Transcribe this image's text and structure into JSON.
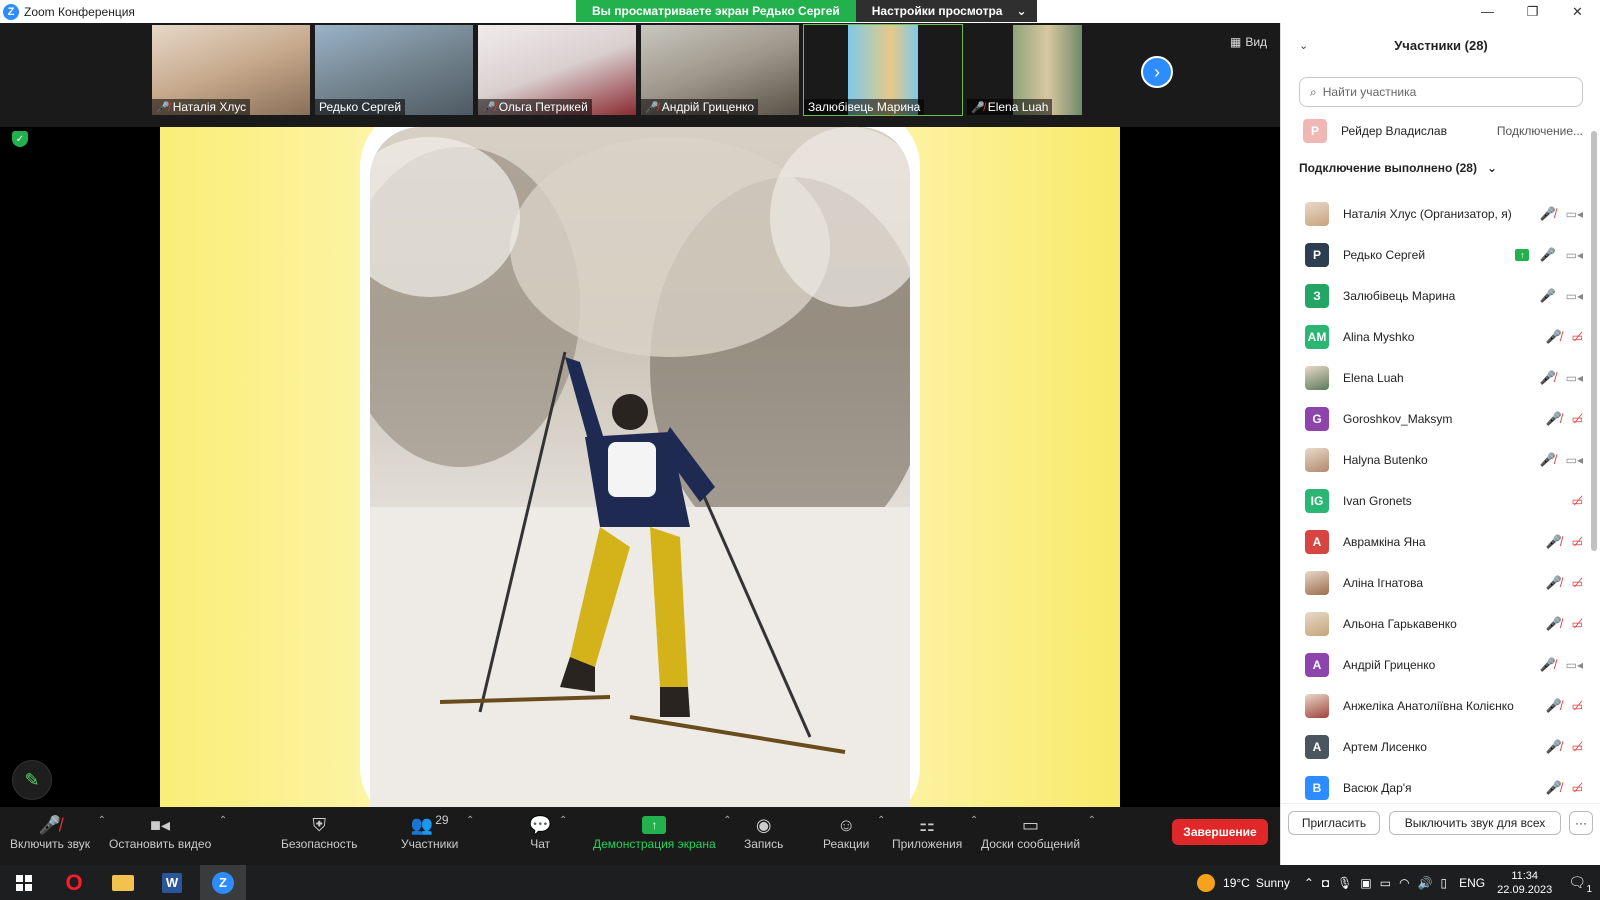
{
  "window": {
    "app_title": "Zoom Конференция",
    "share_banner": "Вы просматриваете экран Редько Сергей",
    "view_settings": "Настройки просмотра",
    "view_label": "Вид"
  },
  "video_tiles": [
    {
      "name": "Наталія Хлус",
      "muted": true
    },
    {
      "name": "Редько Сергей",
      "muted": false
    },
    {
      "name": "Ольга Петрикей",
      "muted": true
    },
    {
      "name": "Андрій Гриценко",
      "muted": true
    },
    {
      "name": "Залюбівець Марина",
      "muted": false
    },
    {
      "name": "Elena Luah",
      "muted": true
    }
  ],
  "toolbar": {
    "unmute": "Включить звук",
    "stop_video": "Остановить видео",
    "security": "Безопасность",
    "participants": "Участники",
    "participants_count": "29",
    "chat": "Чат",
    "share_screen": "Демонстрация экрана",
    "record": "Запись",
    "reactions": "Реакции",
    "apps": "Приложения",
    "whiteboards": "Доски сообщений",
    "end": "Завершение"
  },
  "panel": {
    "title": "Участники (28)",
    "search_placeholder": "Найти участника",
    "pending": {
      "name": "Рейдер Владислав",
      "status": "Подключение...",
      "initial": "Р"
    },
    "section": "Подключение выполнено (28)",
    "participants": [
      {
        "name": "Наталія Хлус (Организатор, я)",
        "initial": "",
        "avatar_color": "#c9a27e",
        "photo": true,
        "mic": "off",
        "cam": "on",
        "sharing": false
      },
      {
        "name": "Редько Сергей",
        "initial": "Р",
        "avatar_color": "#2d3e50",
        "photo": false,
        "mic": "on",
        "cam": "on",
        "sharing": true
      },
      {
        "name": "Залюбівець Марина",
        "initial": "З",
        "avatar_color": "#23a566",
        "photo": false,
        "mic": "on",
        "cam": "on",
        "sharing": false
      },
      {
        "name": "Alina Myshko",
        "initial": "AM",
        "avatar_color": "#2bb673",
        "photo": false,
        "mic": "off",
        "cam": "off",
        "sharing": false
      },
      {
        "name": "Elena Luah",
        "initial": "",
        "avatar_color": "#5a7a5a",
        "photo": true,
        "mic": "off",
        "cam": "on",
        "sharing": false
      },
      {
        "name": "Goroshkov_Maksym",
        "initial": "G",
        "avatar_color": "#8e44ad",
        "photo": false,
        "mic": "off",
        "cam": "off",
        "sharing": false
      },
      {
        "name": "Halyna Butenko",
        "initial": "",
        "avatar_color": "#b08a6e",
        "photo": true,
        "mic": "off",
        "cam": "on",
        "sharing": false
      },
      {
        "name": "Ivan Gronets",
        "initial": "IG",
        "avatar_color": "#2bb673",
        "photo": false,
        "mic": "none",
        "cam": "off",
        "sharing": false
      },
      {
        "name": "Аврамкіна Яна",
        "initial": "А",
        "avatar_color": "#d64541",
        "photo": false,
        "mic": "off",
        "cam": "off",
        "sharing": false
      },
      {
        "name": "Аліна Ігнатова",
        "initial": "",
        "avatar_color": "#9c6b4e",
        "photo": true,
        "mic": "off",
        "cam": "off",
        "sharing": false
      },
      {
        "name": "Альона Гарькавенко",
        "initial": "",
        "avatar_color": "#c4a57a",
        "photo": true,
        "mic": "off",
        "cam": "off",
        "sharing": false
      },
      {
        "name": "Андрій Гриценко",
        "initial": "А",
        "avatar_color": "#8e44ad",
        "photo": false,
        "mic": "off",
        "cam": "on",
        "sharing": false
      },
      {
        "name": "Анжеліка Анатоліївна Колієнко",
        "initial": "",
        "avatar_color": "#a0413c",
        "photo": true,
        "mic": "off",
        "cam": "off",
        "sharing": false
      },
      {
        "name": "Артем Лисенко",
        "initial": "A",
        "avatar_color": "#4a5560",
        "photo": false,
        "mic": "off",
        "cam": "off",
        "sharing": false
      },
      {
        "name": "Васюк Дар'я",
        "initial": "В",
        "avatar_color": "#2d8cff",
        "photo": false,
        "mic": "off",
        "cam": "off",
        "sharing": false
      }
    ],
    "invite": "Пригласить",
    "mute_all": "Выключить звук для всех",
    "more": "···"
  },
  "taskbar": {
    "weather": "19°C",
    "weather_desc": "Sunny",
    "lang": "ENG",
    "time": "11:34",
    "date": "22.09.2023",
    "notifications": "1"
  }
}
